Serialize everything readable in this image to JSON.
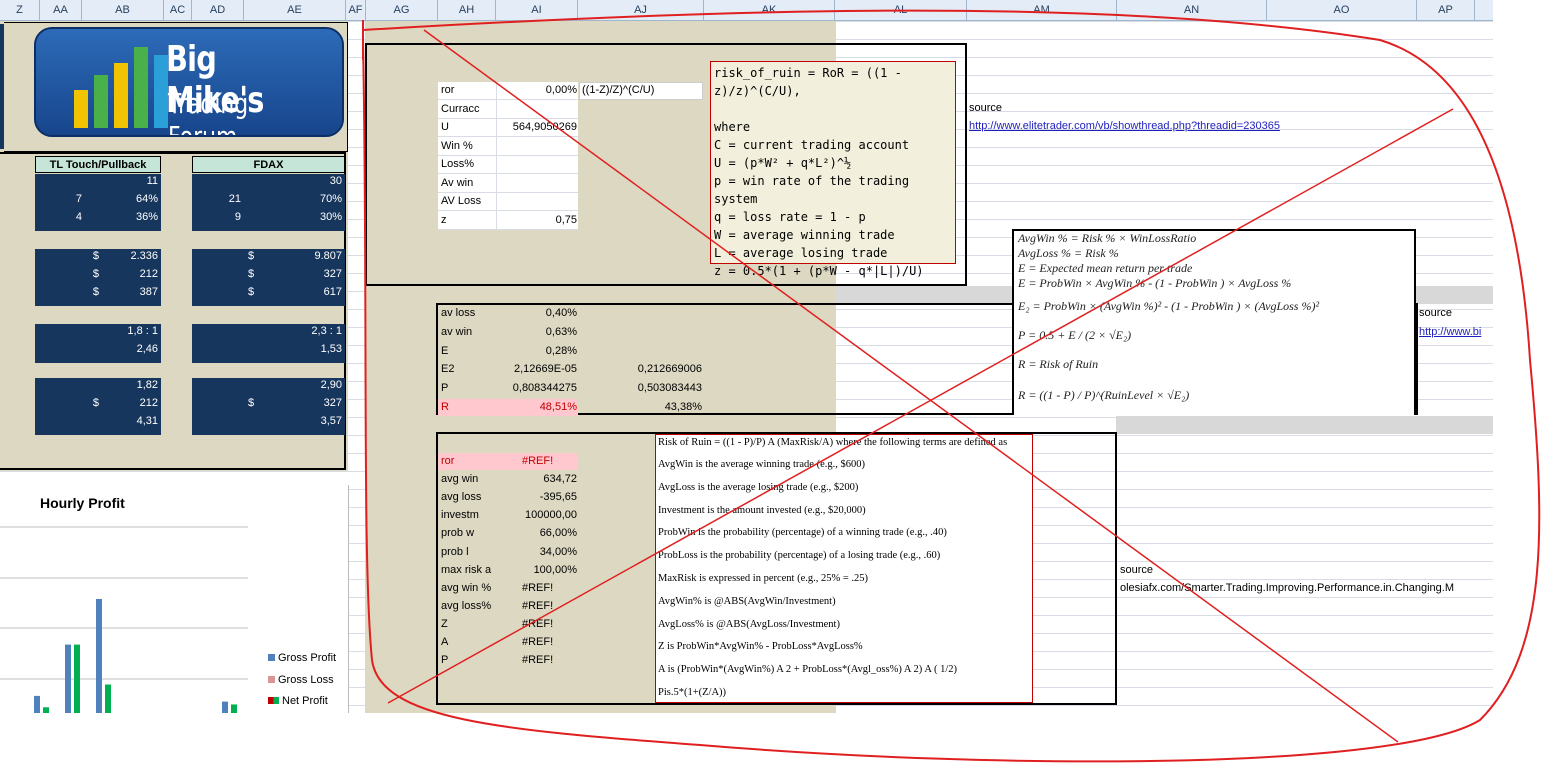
{
  "columns": [
    {
      "label": "Z"
    },
    {
      "label": "AA"
    },
    {
      "label": "AB"
    },
    {
      "label": "AC"
    },
    {
      "label": "AD"
    },
    {
      "label": "AE"
    },
    {
      "label": "AF"
    },
    {
      "label": "AG"
    },
    {
      "label": "AH"
    },
    {
      "label": "AI"
    },
    {
      "label": "AJ"
    },
    {
      "label": "AK"
    },
    {
      "label": "AL"
    },
    {
      "label": "AM"
    },
    {
      "label": "AN"
    },
    {
      "label": "AO"
    },
    {
      "label": "AP"
    }
  ],
  "logo": {
    "line1": "Big Mike's",
    "line2": "Trading Forum"
  },
  "stats": {
    "col1_title": "TL Touch/Pullback",
    "col2_title": "FDAX",
    "rows": [
      {
        "a": "",
        "b": "11",
        "c": "",
        "d": "30"
      },
      {
        "a": "7",
        "b": "64%",
        "c": "21",
        "d": "70%"
      },
      {
        "a": "4",
        "b": "36%",
        "c": "9",
        "d": "30%"
      },
      {
        "a": "$",
        "b": "2.336",
        "c": "$",
        "d": "9.807"
      },
      {
        "a": "$",
        "b": "212",
        "c": "$",
        "d": "327"
      },
      {
        "a": "$",
        "b": "387",
        "c": "$",
        "d": "617"
      },
      {
        "a": "",
        "b": "1,8 : 1",
        "c": "",
        "d": "2,3 : 1"
      },
      {
        "a": "",
        "b": "2,46",
        "c": "",
        "d": "1,53"
      },
      {
        "a": "",
        "b": "1,82",
        "c": "",
        "d": "2,90"
      },
      {
        "a": "$",
        "b": "212",
        "c": "$",
        "d": "327"
      },
      {
        "a": "",
        "b": "4,31",
        "c": "",
        "d": "3,57"
      }
    ]
  },
  "chart": {
    "title": "Hourly Profit",
    "legend": [
      {
        "label": "Gross Profit",
        "color": "#4f81bd"
      },
      {
        "label": "Gross Loss",
        "color": "#d99694"
      },
      {
        "label": "Net Profit",
        "color": "#00b050"
      }
    ],
    "chart_data": {
      "type": "bar",
      "title": "Hourly Profit",
      "series": [
        {
          "name": "Gross Profit",
          "values": [
            0.3,
            1.2,
            2.0,
            0,
            0,
            0,
            0,
            0.2
          ]
        },
        {
          "name": "Net Profit",
          "values": [
            0.1,
            1.2,
            0.5,
            0,
            0,
            0,
            0,
            0.15
          ]
        }
      ]
    }
  },
  "ror_box": {
    "labels": [
      "ror",
      "Curracc",
      "U",
      "Win %",
      "Loss%",
      "Av win",
      "AV Loss",
      "z"
    ],
    "values": [
      "0,00%",
      "",
      "564,9050269",
      "",
      "",
      "",
      "",
      "0,75"
    ],
    "formula": "((1-Z)/Z)^(C/U)"
  },
  "note1": {
    "lines": [
      "risk_of_ruin = RoR = ((1 - z)/z)^(C/U),",
      "",
      "where",
      "C = current trading account",
      "U = (p*W² + q*L²)^½",
      "p = win rate of the trading system",
      "q = loss rate = 1 - p",
      "W = average winning trade",
      "L = average losing trade",
      "z = 0.5*(1 + (p*W - q*|L|)/U)"
    ]
  },
  "source1": {
    "label": "source",
    "url": "http://www.elitetrader.com/vb/showthread.php?threadid=230365"
  },
  "box2": {
    "rows": [
      {
        "label": "av loss",
        "v1": "0,40%",
        "v2": ""
      },
      {
        "label": "av win",
        "v1": "0,63%",
        "v2": ""
      },
      {
        "label": "E",
        "v1": "0,28%",
        "v2": ""
      },
      {
        "label": "E2",
        "v1": "2,12669E-05",
        "v2": "0,212669006"
      },
      {
        "label": "P",
        "v1": "0,808344275",
        "v2": "0,503083443"
      },
      {
        "label": "R",
        "v1": "48,51%",
        "v2": "43,38%"
      }
    ]
  },
  "formulas": {
    "l1": "AvgWin % = Risk % × WinLossRatio",
    "l2": "AvgLoss % = Risk %",
    "l3": "E = Expected mean return per trade",
    "l4": "E = ProbWin × AvgWin % - (1 - ProbWin ) × AvgLoss %",
    "l5": "E₂ = ProbWin × (AvgWin %)² - (1 - ProbWin ) × (AvgLoss %)²",
    "l6": "P = 0.5 + E / (2 × √E₂)",
    "l7": "R = Risk of Ruin",
    "l8": "R = ((1 - P) / P)^(RuinLevel × √E₂)"
  },
  "source2": {
    "label": "source",
    "url": "http://www.bi"
  },
  "box3": {
    "rows": [
      {
        "label": "ror",
        "value": "#REF!"
      },
      {
        "label": "avg win",
        "value": "634,72"
      },
      {
        "label": "avg loss",
        "value": "-395,65"
      },
      {
        "label": "investm",
        "value": "100000,00"
      },
      {
        "label": "prob w",
        "value": "66,00%"
      },
      {
        "label": "prob l",
        "value": "34,00%"
      },
      {
        "label": "max risk a",
        "value": "100,00%"
      },
      {
        "label": "avg win %",
        "value": "#REF!"
      },
      {
        "label": "avg loss%",
        "value": "#REF!"
      },
      {
        "label": "Z",
        "value": "#REF!"
      },
      {
        "label": "A",
        "value": "#REF!"
      },
      {
        "label": "P",
        "value": "#REF!"
      }
    ]
  },
  "note3": {
    "lines": [
      "Risk of Ruin = ((1 - P)/P) A (MaxRisk/A) where the following terms are defined as",
      "AvgWin is the average winning trade (e.g., $600)",
      "AvgLoss is the average losing trade (e.g., $200)",
      "Investment is the amount invested (e.g., $20,000)",
      "ProbWin is the probability (percentage) of a winning trade (e.g., .40)",
      "ProbLoss is the probability (percentage) of a losing trade (e.g., .60)",
      "MaxRisk is expressed in percent (e.g., 25% = .25)",
      "AvgWin% is @ABS(AvgWin/Investment)",
      "AvgLoss% is @ABS(AvgLoss/Investment)",
      "Z is ProbWin*AvgWin% - ProbLoss*AvgLoss%",
      "A is (ProbWin*(AvgWin%) A 2 + ProbLoss*(Avgl_oss%) A 2) A ( 1/2)",
      "Pis.5*(1+(Z/A))"
    ]
  },
  "source3": {
    "label": "source",
    "url": "olesiafx.com/Smarter.Trading.Improving.Performance.in.Changing.M"
  },
  "colors": {
    "navy": "#17365d",
    "tan": "#ddd8c2",
    "teal": "#c4e5d8",
    "pink": "#ffc7ce",
    "red": "#e02020"
  }
}
